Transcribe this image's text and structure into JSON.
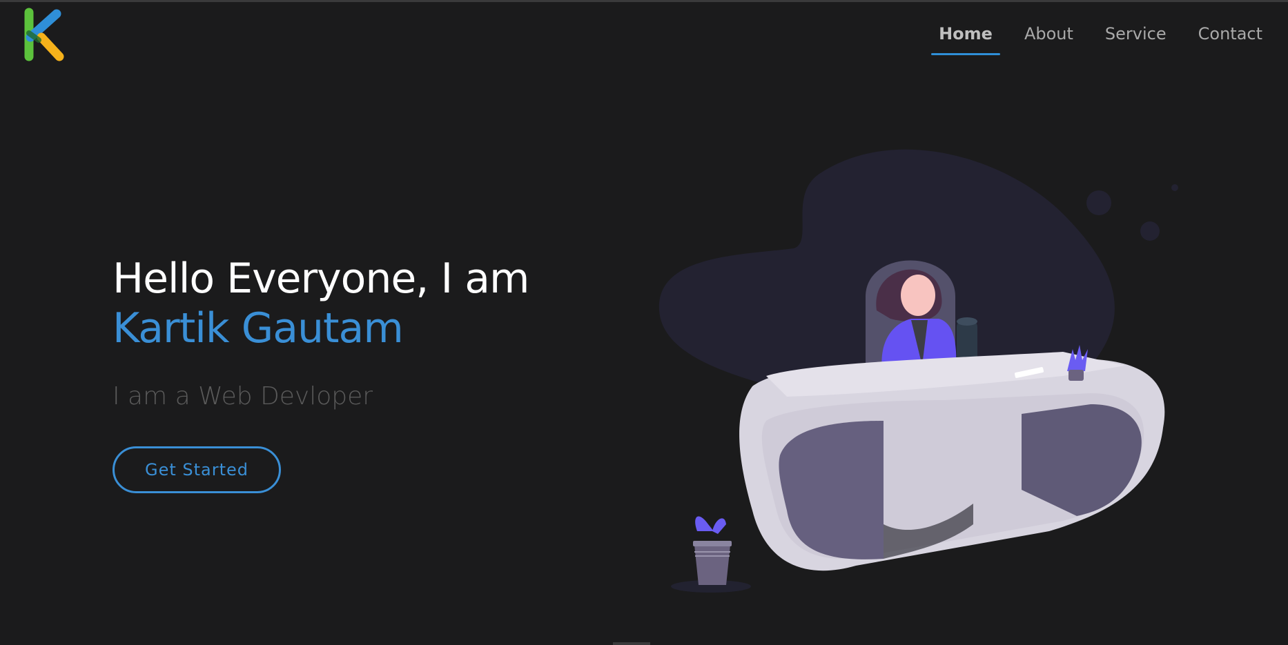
{
  "nav": {
    "items": [
      {
        "label": "Home",
        "active": true
      },
      {
        "label": "About",
        "active": false
      },
      {
        "label": "Service",
        "active": false
      },
      {
        "label": "Contact",
        "active": false
      }
    ]
  },
  "hero": {
    "greeting": "Hello Everyone, I am",
    "name": "Kartik Gautam",
    "role": "I am a Web Devloper",
    "cta_label": "Get Started"
  },
  "colors": {
    "background": "#1b1b1c",
    "accent": "#3a8fd6",
    "heading": "#ffffff",
    "subtle": "#5a5a5a"
  },
  "icons": {
    "logo": "k-logo-icon",
    "illustration": "person-at-desk-illustration"
  }
}
